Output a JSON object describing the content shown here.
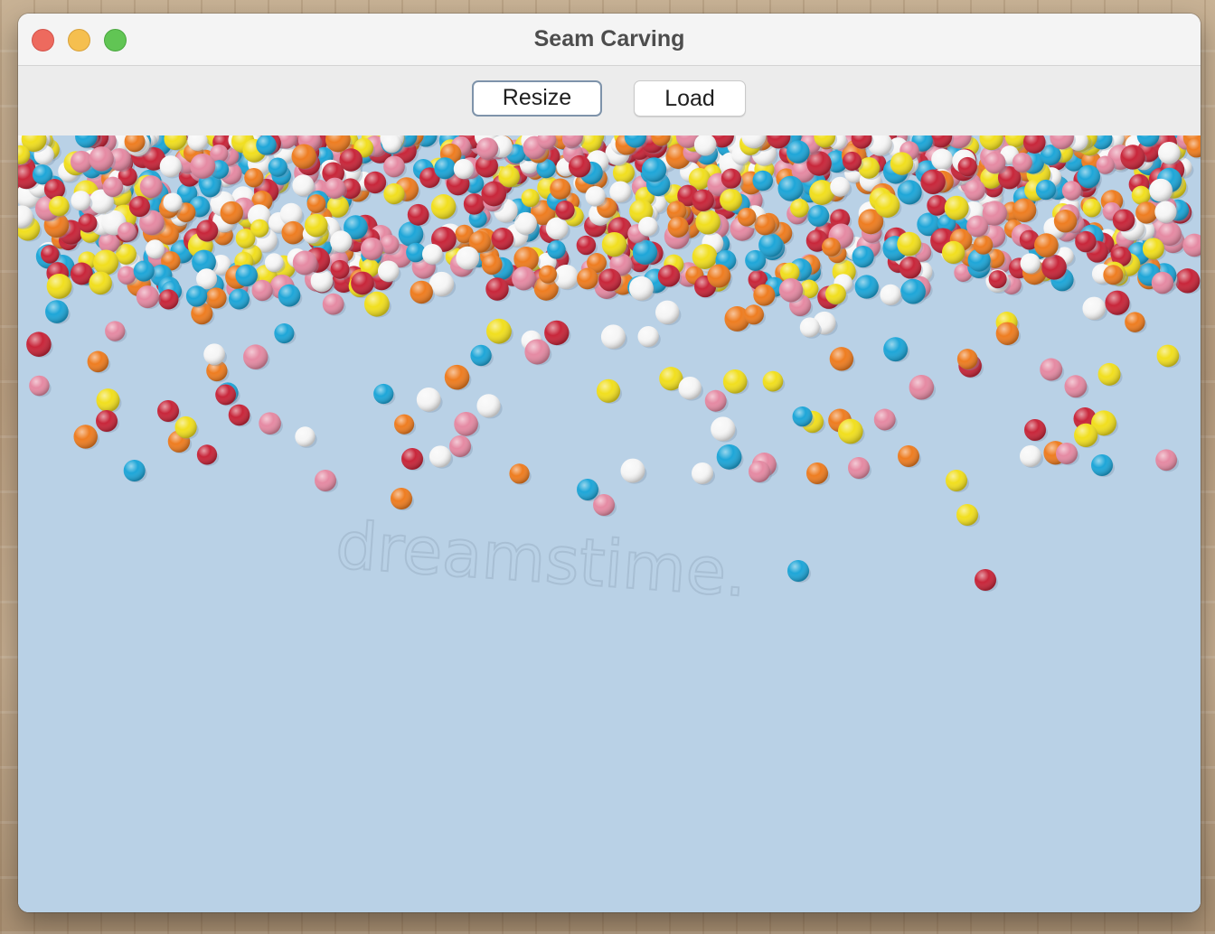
{
  "window": {
    "title": "Seam Carving"
  },
  "toolbar": {
    "resize_label": "Resize",
    "load_label": "Load"
  },
  "image": {
    "subject": "colorful sprinkles on light blue background",
    "background_color": "#b9d1e6",
    "watermark_text": "dreamstime."
  },
  "colors": {
    "sprinkle_red": "#c8263a",
    "sprinkle_yellow": "#f1df1f",
    "sprinkle_blue": "#1ea6d8",
    "sprinkle_orange": "#ee7d21",
    "sprinkle_pink": "#e58aa3",
    "sprinkle_white": "#f6f6f6"
  }
}
